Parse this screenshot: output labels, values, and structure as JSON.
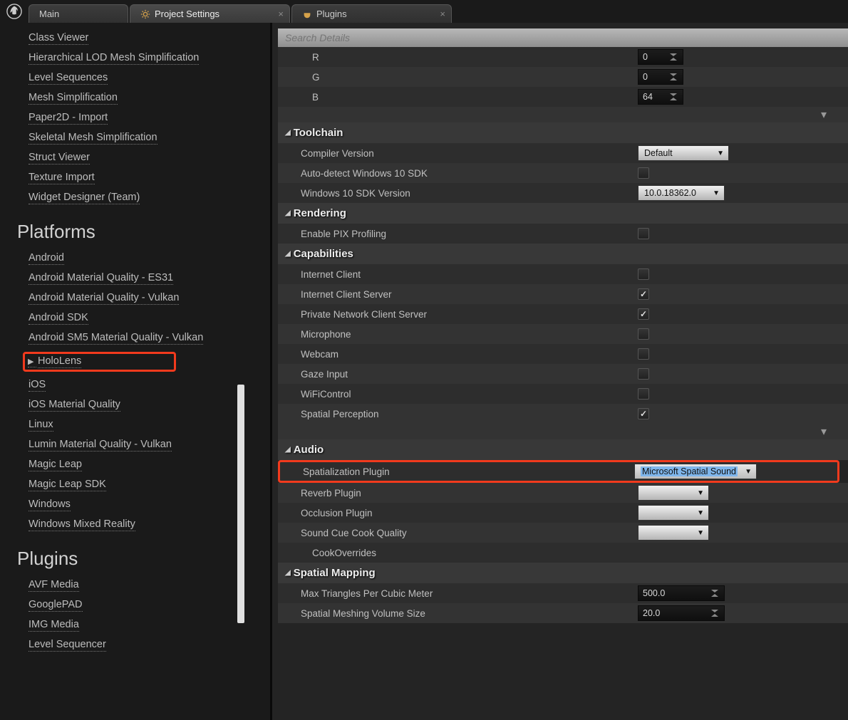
{
  "tabs": [
    {
      "label": "Main",
      "active": false,
      "closable": false
    },
    {
      "label": "Project Settings",
      "active": true,
      "closable": true,
      "icon": "gear"
    },
    {
      "label": "Plugins",
      "active": false,
      "closable": true,
      "icon": "plug"
    }
  ],
  "sidebar": {
    "editor_items": [
      "Class Viewer",
      "Hierarchical LOD Mesh Simplification",
      "Level Sequences",
      "Mesh Simplification",
      "Paper2D - Import",
      "Skeletal Mesh Simplification",
      "Struct Viewer",
      "Texture Import",
      "Widget Designer (Team)"
    ],
    "platforms_heading": "Platforms",
    "platform_items_before": [
      "Android",
      "Android Material Quality - ES31",
      "Android Material Quality - Vulkan",
      "Android SDK",
      "Android SM5 Material Quality - Vulkan"
    ],
    "hololens": "HoloLens",
    "platform_items_after": [
      "iOS",
      "iOS Material Quality",
      "Linux",
      "Lumin Material Quality - Vulkan",
      "Magic Leap",
      "Magic Leap SDK",
      "Windows",
      "Windows Mixed Reality"
    ],
    "plugins_heading": "Plugins",
    "plugin_items": [
      "AVF Media",
      "GooglePAD",
      "IMG Media",
      "Level Sequencer"
    ]
  },
  "search_placeholder": "Search Details",
  "rgb": {
    "r_label": "R",
    "r_val": "0",
    "g_label": "G",
    "g_val": "0",
    "b_label": "B",
    "b_val": "64"
  },
  "sections": {
    "toolchain": {
      "title": "Toolchain",
      "compiler_label": "Compiler Version",
      "compiler_val": "Default",
      "autodetect_label": "Auto-detect Windows 10 SDK",
      "sdk_label": "Windows 10 SDK Version",
      "sdk_val": "10.0.18362.0"
    },
    "rendering": {
      "title": "Rendering",
      "pix_label": "Enable PIX Profiling"
    },
    "capabilities": {
      "title": "Capabilities",
      "items": [
        {
          "label": "Internet Client",
          "checked": false
        },
        {
          "label": "Internet Client Server",
          "checked": true
        },
        {
          "label": "Private Network Client Server",
          "checked": true
        },
        {
          "label": "Microphone",
          "checked": false
        },
        {
          "label": "Webcam",
          "checked": false
        },
        {
          "label": "Gaze Input",
          "checked": false
        },
        {
          "label": "WiFiControl",
          "checked": false
        },
        {
          "label": "Spatial Perception",
          "checked": true
        }
      ]
    },
    "audio": {
      "title": "Audio",
      "spatialization_label": "Spatialization Plugin",
      "spatialization_val": "Microsoft Spatial Sound",
      "reverb_label": "Reverb Plugin",
      "occlusion_label": "Occlusion Plugin",
      "soundcue_label": "Sound Cue Cook Quality",
      "cookoverrides_label": "CookOverrides"
    },
    "spatialmapping": {
      "title": "Spatial Mapping",
      "max_tri_label": "Max Triangles Per Cubic Meter",
      "max_tri_val": "500.0",
      "vol_label": "Spatial Meshing Volume Size",
      "vol_val": "20.0"
    }
  }
}
